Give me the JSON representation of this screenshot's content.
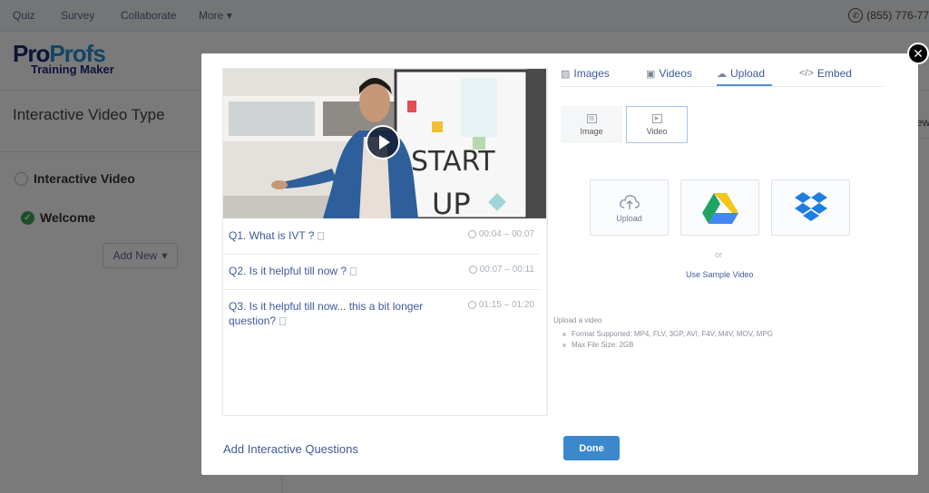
{
  "topnav": {
    "items": [
      "Quiz",
      "Survey",
      "Collaborate",
      "More"
    ],
    "phone": "(855) 776-77"
  },
  "brand": {
    "pro": "Pro",
    "profs": "Profs",
    "sub": "Training Maker"
  },
  "sidebar": {
    "title": "Interactive Video Type",
    "items": [
      {
        "label": "Interactive Video",
        "state": "unchecked"
      },
      {
        "label": "Welcome",
        "state": "checked"
      }
    ],
    "add_new": "Add New",
    "right_fragment": "ew"
  },
  "modal": {
    "close_symbol": "✕",
    "questions": [
      {
        "label": "Q1. What is IVT ?",
        "time": "00:04  –  00:07"
      },
      {
        "label": "Q2. Is it helpful till now ?",
        "time": "00:07 – 00:11"
      },
      {
        "label": "Q3. Is it helpful till now... this a bit longer question?",
        "time": "01:15 – 01:20"
      }
    ],
    "add_questions": "Add Interactive Questions",
    "done": "Done",
    "tabs": [
      {
        "label": "Images",
        "icon": "image-icon"
      },
      {
        "label": "Videos",
        "icon": "video-icon"
      },
      {
        "label": "Upload",
        "icon": "cloud-upload-icon",
        "active": true
      },
      {
        "label": "Embed",
        "icon": "code-icon"
      }
    ],
    "media_types": [
      {
        "label": "Image"
      },
      {
        "label": "Video",
        "selected": true
      }
    ],
    "sources": [
      {
        "label": "Upload",
        "icon": "cloud-upload-icon"
      },
      {
        "label": "",
        "icon": "google-drive-icon"
      },
      {
        "label": "",
        "icon": "dropbox-icon"
      }
    ],
    "or": "or",
    "sample": "Use Sample Video",
    "upload_info": {
      "title": "Upload a video",
      "items": [
        "Format Supported: MP4, FLV, 3GP, AVI, F4V, M4V, MOV, MPG",
        "Max File Size: 2GB"
      ]
    },
    "video_whiteboard_text": [
      "START",
      "UP"
    ]
  },
  "colors": {
    "accent": "#3c88cc",
    "link": "#3d5a9a",
    "success": "#3aa655"
  }
}
